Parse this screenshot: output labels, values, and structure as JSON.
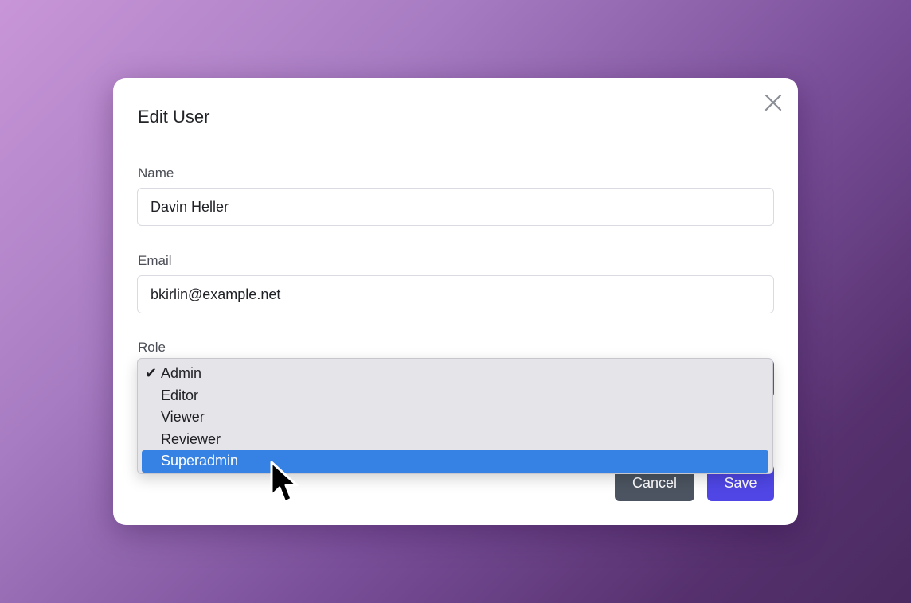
{
  "dialog": {
    "title": "Edit User",
    "close_icon": "close-icon"
  },
  "form": {
    "name": {
      "label": "Name",
      "value": "Davin Heller"
    },
    "email": {
      "label": "Email",
      "value": "bkirlin@example.net"
    },
    "role": {
      "label": "Role",
      "selected": "Admin",
      "highlighted": "Superadmin",
      "options": [
        "Admin",
        "Editor",
        "Viewer",
        "Reviewer",
        "Superadmin"
      ]
    }
  },
  "actions": {
    "cancel_label": "Cancel",
    "save_label": "Save"
  },
  "colors": {
    "accent": "#4f46e5",
    "cancel": "#4b5460",
    "highlight": "#3582e4"
  }
}
